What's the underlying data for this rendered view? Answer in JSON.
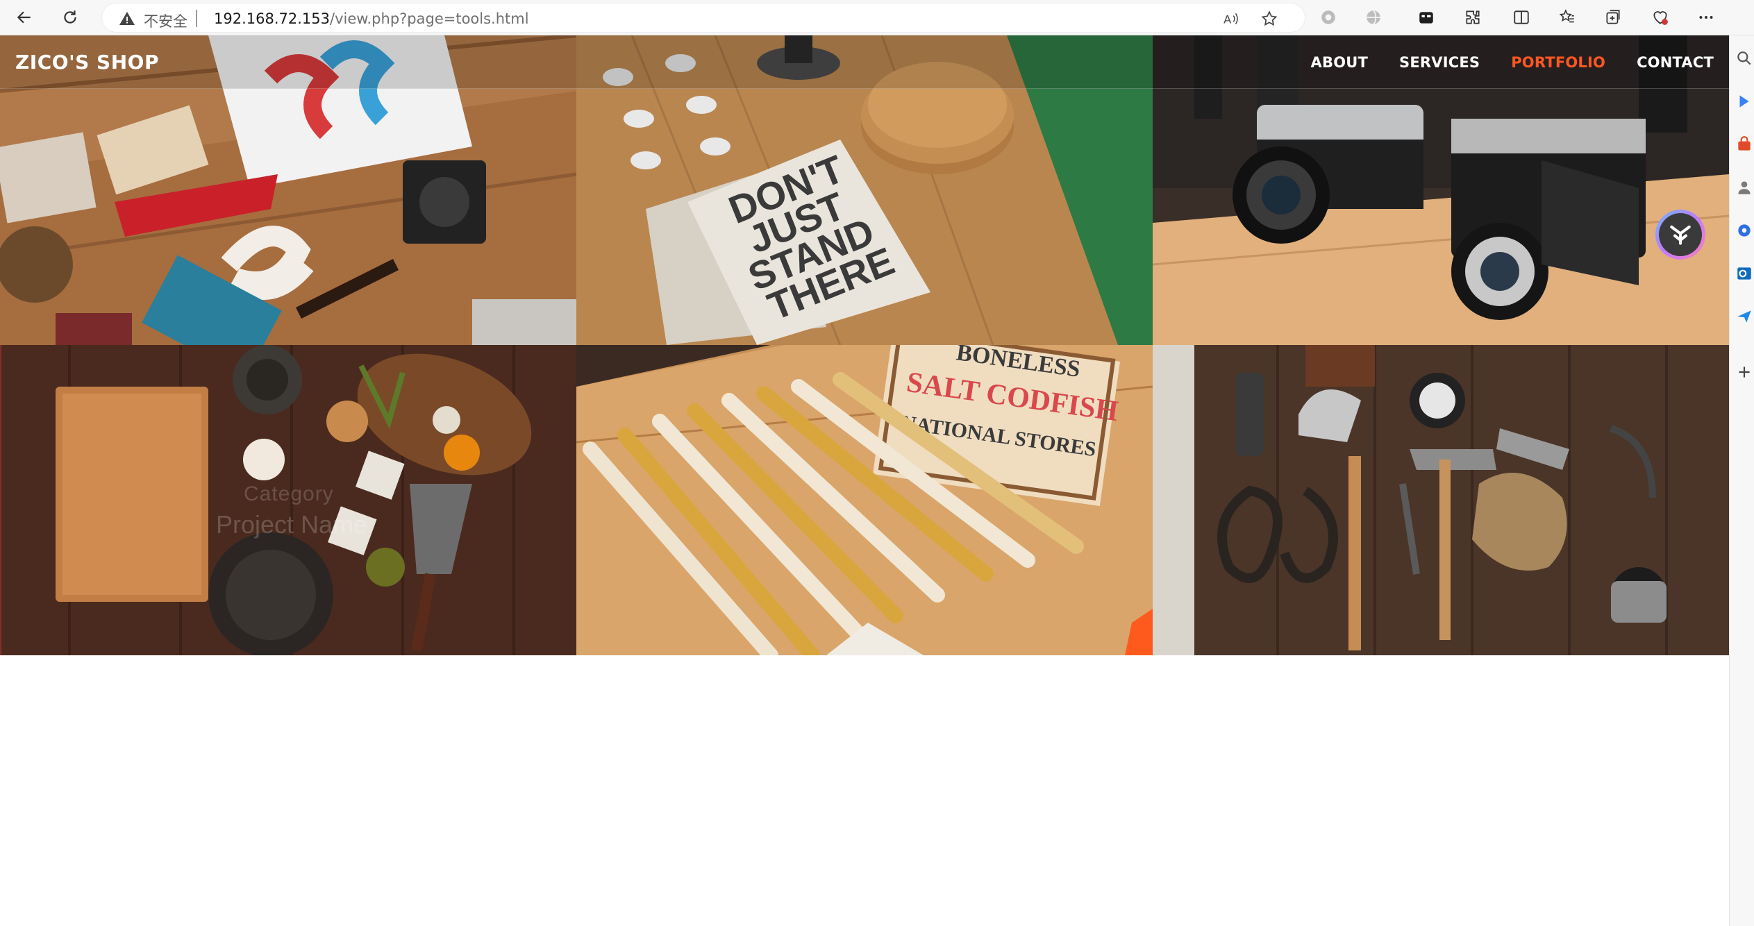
{
  "browser": {
    "security_label": "不安全",
    "url_host": "192.168.72.153",
    "url_path": "/view.php?page=tools.html"
  },
  "site": {
    "brand": "ZICO'S SHOP",
    "nav": [
      {
        "label": "ABOUT",
        "active": false
      },
      {
        "label": "SERVICES",
        "active": false
      },
      {
        "label": "PORTFOLIO",
        "active": true
      },
      {
        "label": "CONTACT",
        "active": false
      }
    ],
    "accent_color": "#ff5722"
  },
  "portfolio": {
    "items": [
      {
        "scene": "design-flatlay"
      },
      {
        "scene": "notebook-dont-just-stand-there",
        "notebook_text": [
          "DON'T",
          "JUST",
          "STAND",
          "THERE"
        ]
      },
      {
        "scene": "vintage-cameras"
      },
      {
        "scene": "kitchen-flatlay",
        "category": "Category",
        "name": "Project Name"
      },
      {
        "scene": "folding-rulers",
        "sign_text": [
          "BONELESS",
          "SALT CODFISH",
          "NATIONAL STORES"
        ]
      },
      {
        "scene": "vintage-tools"
      }
    ]
  }
}
